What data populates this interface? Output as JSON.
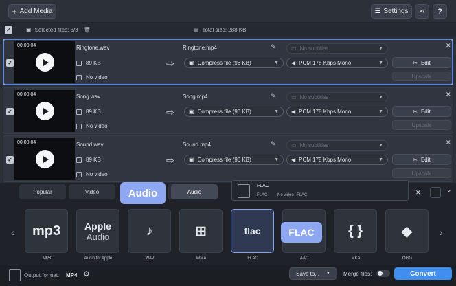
{
  "toolbar": {
    "add_media": "Add Media",
    "settings": "Settings",
    "help": "?"
  },
  "selection": {
    "selected": "Selected files: 3/3",
    "total": "Total size: 288 KB"
  },
  "files": [
    {
      "duration": "00:00:04",
      "src": "Ringtone.wav",
      "size": "89 KB",
      "video": "No video",
      "dst": "Ringtone.mp4",
      "subtitles": "No subtitles",
      "compress": "Compress file (96 KB)",
      "audio": "PCM 178 Kbps Mono",
      "edit": "Edit",
      "upscale": "Upscale"
    },
    {
      "duration": "00:00:04",
      "src": "Song.wav",
      "size": "89 KB",
      "video": "No video",
      "dst": "Song.mp4",
      "subtitles": "No subtitles",
      "compress": "Compress file (96 KB)",
      "audio": "PCM 178 Kbps Mono",
      "edit": "Edit",
      "upscale": "Upscale"
    },
    {
      "duration": "00:00:04",
      "src": "Sound.wav",
      "size": "89 KB",
      "video": "No video",
      "dst": "Sound.mp4",
      "subtitles": "No subtitles",
      "compress": "Compress file (96 KB)",
      "audio": "PCM 178 Kbps Mono",
      "edit": "Edit",
      "upscale": "Upscale"
    }
  ],
  "tabs": [
    "Popular",
    "Video",
    "Audio"
  ],
  "callout_audio": "Audio",
  "callout_flac": "FLAC",
  "tooltip": {
    "title": "FLAC",
    "a": "FLAC",
    "b": "No video",
    "c": "FLAC"
  },
  "formats": [
    {
      "label": "MP3",
      "glyph": "mp3"
    },
    {
      "label": "Audio for Apple",
      "glyph": "Apple",
      "glyph2": "Audio"
    },
    {
      "label": "WAV",
      "glyph": "♪"
    },
    {
      "label": "WMA",
      "glyph": "⊞"
    },
    {
      "label": "FLAC",
      "glyph": "flac"
    },
    {
      "label": "AAC",
      "glyph": ""
    },
    {
      "label": "MKA",
      "glyph": "{ }"
    },
    {
      "label": "OGG",
      "glyph": "◆"
    }
  ],
  "bottom": {
    "output_label": "Output format:",
    "output_value": "MP4",
    "save_to": "Save to...",
    "merge": "Merge files:",
    "convert": "Convert"
  }
}
